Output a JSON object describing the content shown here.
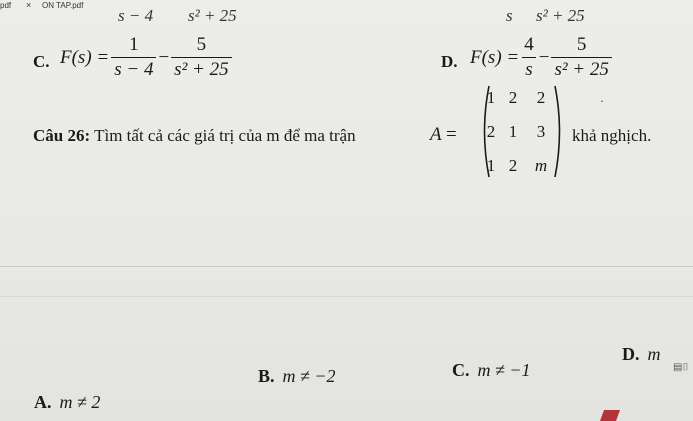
{
  "tabs": {
    "left": "pdf",
    "close": "×",
    "file": "ON TAP.pdf"
  },
  "cutoff": {
    "left_a": "s − 4",
    "left_b": "s² + 25",
    "right_a": "s",
    "right_b": "s² + 25"
  },
  "option_c_top": {
    "label": "C.",
    "fx": "F(s) =",
    "f1_num": "1",
    "f1_den": "s − 4",
    "minus": "−",
    "f2_num": "5",
    "f2_den": "s² + 25"
  },
  "option_d_top": {
    "label": "D.",
    "fx": "F(s) =",
    "f1_num": "4",
    "f1_den": "s",
    "minus": "−",
    "f2_num": "5",
    "f2_den": "s² + 25"
  },
  "question": {
    "number": "Câu 26:",
    "text": " Tìm  tất cả các giá trị của m để ma trận",
    "matrix_name": "A",
    "equals": "=",
    "matrix": [
      [
        "1",
        "2",
        "2"
      ],
      [
        "2",
        "1",
        "3"
      ],
      [
        "1",
        "2",
        "m"
      ]
    ],
    "tail": "khả nghịch."
  },
  "answers": {
    "a": {
      "label": "A.",
      "value": "m ≠ 2"
    },
    "b": {
      "label": "B.",
      "value": "m ≠ −2"
    },
    "c": {
      "label": "C.",
      "value": "m ≠ −1"
    },
    "d": {
      "label": "D.",
      "value": "m"
    }
  }
}
